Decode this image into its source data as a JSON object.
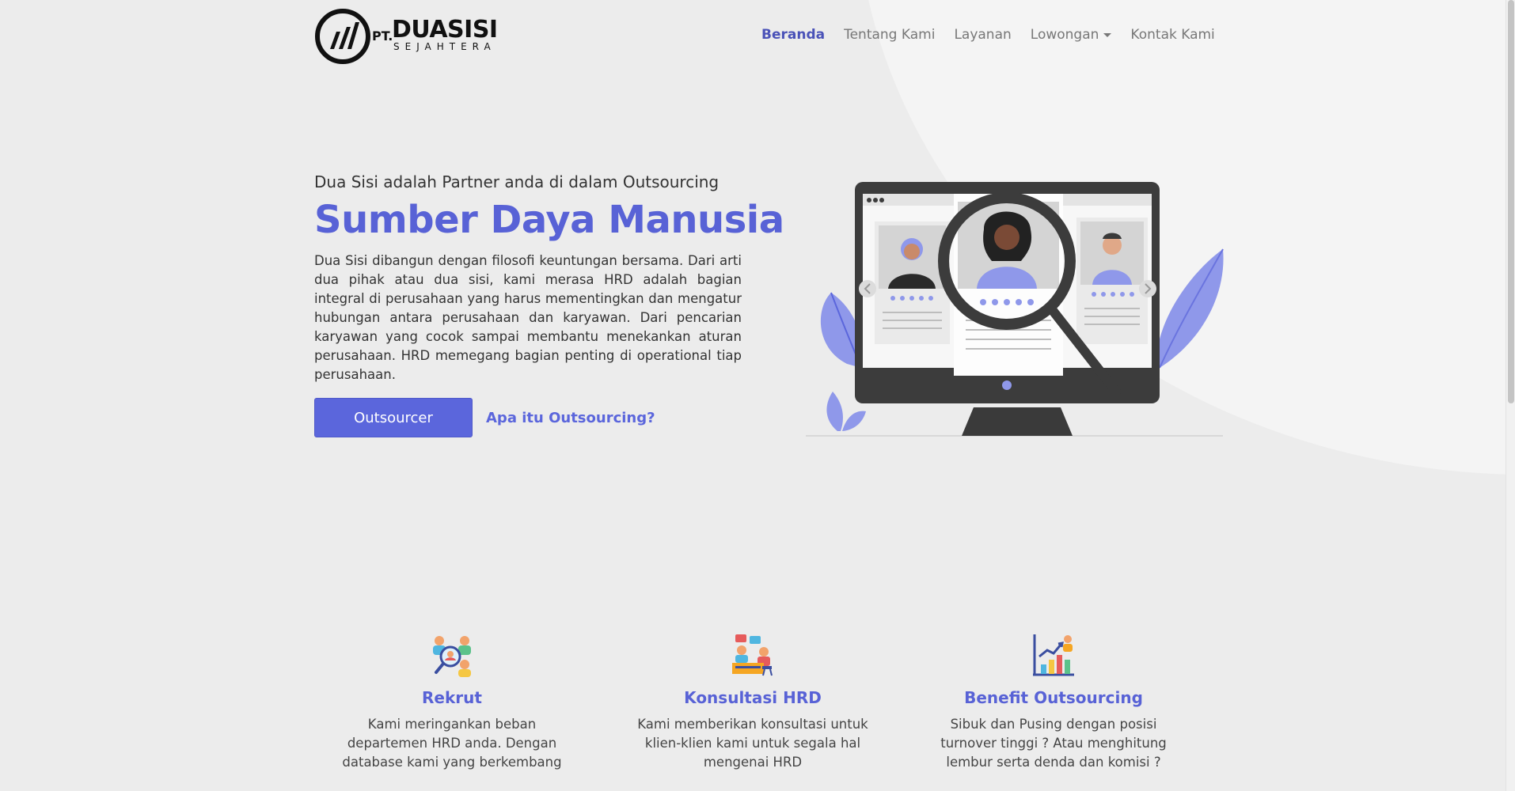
{
  "brand": {
    "pt": "PT.",
    "name": "DUASISI",
    "sub": "SEJAHTERA",
    "accent": "#5862d6"
  },
  "nav": {
    "items": [
      {
        "label": "Beranda",
        "active": true
      },
      {
        "label": "Tentang Kami"
      },
      {
        "label": "Layanan"
      },
      {
        "label": "Lowongan",
        "dropdown": true
      },
      {
        "label": "Kontak Kami"
      }
    ]
  },
  "hero": {
    "tagline": "Dua Sisi adalah Partner anda di dalam Outsourcing",
    "title": "Sumber Daya Manusia",
    "description": "Dua Sisi dibangun dengan filosofi keuntungan bersama. Dari arti dua pihak atau dua sisi, kami merasa HRD adalah bagian integral di perusahaan yang harus mementingkan dan mengatur hubungan antara perusahaan dan karyawan. Dari pencarian karyawan yang cocok sampai membantu menekankan aturan perusahaan. HRD memegang bagian penting di operational tiap perusahaan.",
    "primary_button": "Outsourcer",
    "secondary_link": "Apa itu Outsourcing?"
  },
  "features": [
    {
      "title": "Rekrut",
      "description": "Kami meringankan beban departemen HRD anda. Dengan database kami yang berkembang",
      "icon": "recruit-icon"
    },
    {
      "title": "Konsultasi HRD",
      "description": "Kami memberikan konsultasi untuk klien-klien kami untuk segala hal mengenai HRD",
      "icon": "consultation-icon"
    },
    {
      "title": "Benefit Outsourcing",
      "description": "Sibuk dan Pusing dengan posisi turnover tinggi ? Atau menghitung lembur serta denda dan komisi ?",
      "icon": "benefit-chart-icon"
    }
  ],
  "colors": {
    "primary": "#5b66dc",
    "text": "#333333",
    "nav_inactive": "#777777",
    "background": "#ececec"
  }
}
